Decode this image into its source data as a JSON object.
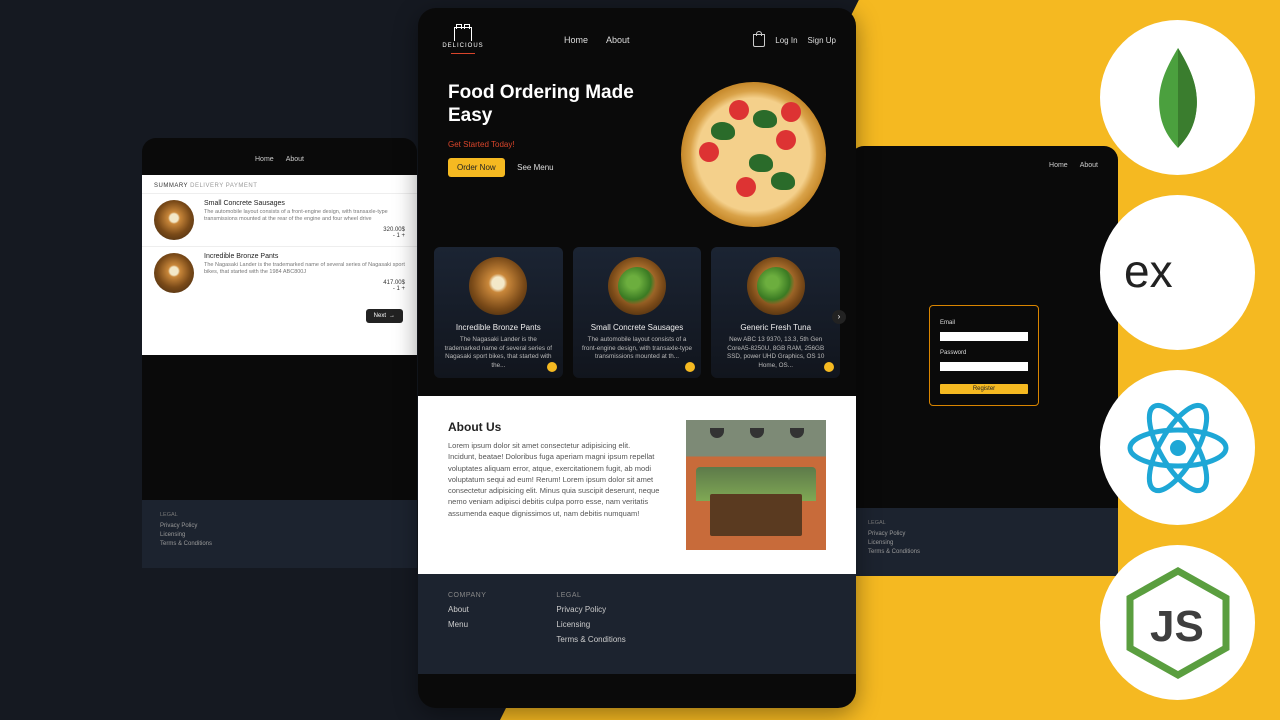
{
  "brand": "DELICIOUS",
  "nav": {
    "home": "Home",
    "about": "About",
    "login": "Log In",
    "signup": "Sign Up"
  },
  "hero": {
    "headline": "Food Ordering Made Easy",
    "tagline": "Get Started Today!",
    "order_btn": "Order Now",
    "see_menu": "See Menu"
  },
  "cards": [
    {
      "title": "Incredible Bronze Pants",
      "desc": "The Nagasaki Lander is the trademarked name of several series of Nagasaki sport bikes, that started with the..."
    },
    {
      "title": "Small Concrete Sausages",
      "desc": "The automobile layout consists of a front-engine design, with transaxle-type transmissions mounted at th..."
    },
    {
      "title": "Generic Fresh Tuna",
      "desc": "New ABC 13 9370, 13.3, 5th Gen CoreA5-8250U, 8GB RAM, 256GB SSD, power UHD Graphics, OS 10 Home, OS..."
    }
  ],
  "about": {
    "heading": "About Us",
    "body": "Lorem ipsum dolor sit amet consectetur adipisicing elit. Incidunt, beatae! Doloribus fuga aperiam magni ipsum repellat voluptates aliquam error, atque, exercitationem fugit, ab modi voluptatum sequi ad eum! Rerum! Lorem ipsum dolor sit amet consectetur adipisicing elit. Minus quia suscipit deserunt, neque nemo veniam adipisci debitis culpa porro esse, nam veritatis assumenda eaque dignissimos ut, nam debitis numquam!"
  },
  "footer": {
    "company_h": "COMPANY",
    "legal_h": "LEGAL",
    "company": [
      "About",
      "Menu"
    ],
    "legal": [
      "Privacy Policy",
      "Licensing",
      "Terms & Conditions"
    ]
  },
  "left_panel": {
    "nav": [
      "Home",
      "About"
    ],
    "crumbs": [
      "SUMMARY",
      "DELIVERY",
      "PAYMENT"
    ],
    "items": [
      {
        "title": "Small Concrete Sausages",
        "desc": "The automobile layout consists of a front-engine design, with transaxle-type transmissions mounted at the rear of the engine and four wheel drive",
        "price": "320.00$",
        "qty": "- 1 +"
      },
      {
        "title": "Incredible Bronze Pants",
        "desc": "The Nagasaki Lander is the trademarked name of several series of Nagasaki sport bikes, that started with the 1984 ABC800J",
        "price": "417.00$",
        "qty": "- 1 +"
      }
    ],
    "next": "Next",
    "foot_h": "LEGAL",
    "foot": [
      "Privacy Policy",
      "Licensing",
      "Terms & Conditions"
    ]
  },
  "right_panel": {
    "nav": [
      "Home",
      "About"
    ],
    "email_lab": "Email",
    "pass_lab": "Password",
    "register": "Register",
    "foot_h": "LEGAL",
    "foot": [
      "Privacy Policy",
      "Licensing",
      "Terms & Conditions"
    ]
  },
  "stack_icons": [
    "mongodb",
    "express",
    "react",
    "nodejs"
  ]
}
